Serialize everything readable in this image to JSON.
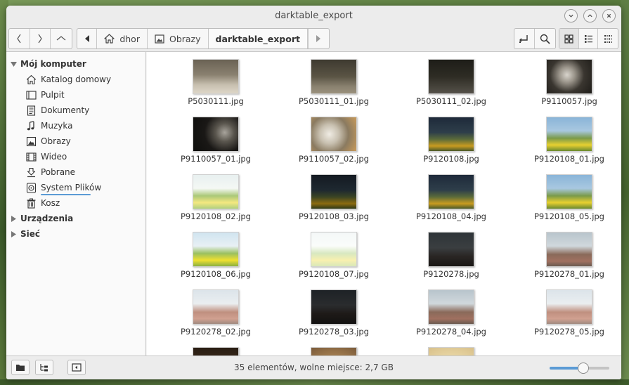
{
  "window": {
    "title": "darktable_export"
  },
  "toolbar": {
    "back_icon": "chevron-left-icon",
    "forward_icon": "chevron-right-icon",
    "up_icon": "chevron-up-icon",
    "breadcrumb": [
      {
        "label": "dhor",
        "icon": "home-icon"
      },
      {
        "label": "Obrazy",
        "icon": "image-folder-icon"
      },
      {
        "label": "darktable_export",
        "icon": ""
      }
    ],
    "active_view": "icons"
  },
  "sidebar": {
    "sections": [
      {
        "label": "Mój komputer",
        "expanded": true
      },
      {
        "label": "Urządzenia",
        "expanded": false
      },
      {
        "label": "Sieć",
        "expanded": false
      }
    ],
    "items": [
      {
        "label": "Katalog domowy",
        "icon": "home-icon"
      },
      {
        "label": "Pulpit",
        "icon": "desktop-icon"
      },
      {
        "label": "Dokumenty",
        "icon": "document-icon"
      },
      {
        "label": "Muzyka",
        "icon": "music-icon"
      },
      {
        "label": "Obrazy",
        "icon": "image-icon"
      },
      {
        "label": "Wideo",
        "icon": "video-icon"
      },
      {
        "label": "Pobrane",
        "icon": "download-icon"
      },
      {
        "label": "System Plików",
        "icon": "drive-icon"
      },
      {
        "label": "Kosz",
        "icon": "trash-icon"
      }
    ]
  },
  "files": [
    {
      "name": "P5030111.jpg",
      "theme": "forest"
    },
    {
      "name": "P5030111_01.jpg",
      "theme": "forest-dark"
    },
    {
      "name": "P5030111_02.jpg",
      "theme": "forest-darker"
    },
    {
      "name": "P9110057.jpg",
      "theme": "sculpture"
    },
    {
      "name": "P9110057_01.jpg",
      "theme": "sculpture-dark"
    },
    {
      "name": "P9110057_02.jpg",
      "theme": "sculpture-light"
    },
    {
      "name": "P9120108.jpg",
      "theme": "fountain-dark"
    },
    {
      "name": "P9120108_01.jpg",
      "theme": "fountain"
    },
    {
      "name": "P9120108_02.jpg",
      "theme": "fountain-light"
    },
    {
      "name": "P9120108_03.jpg",
      "theme": "fountain-darker"
    },
    {
      "name": "P9120108_04.jpg",
      "theme": "fountain-dark"
    },
    {
      "name": "P9120108_05.jpg",
      "theme": "fountain"
    },
    {
      "name": "P9120108_06.jpg",
      "theme": "fountain-bright"
    },
    {
      "name": "P9120108_07.jpg",
      "theme": "fountain-washed"
    },
    {
      "name": "P9120278.jpg",
      "theme": "city-dark"
    },
    {
      "name": "P9120278_01.jpg",
      "theme": "city"
    },
    {
      "name": "P9120278_02.jpg",
      "theme": "city-light"
    },
    {
      "name": "P9120278_03.jpg",
      "theme": "city-darker"
    },
    {
      "name": "P9120278_04.jpg",
      "theme": "city"
    },
    {
      "name": "P9120278_05.jpg",
      "theme": "city-light"
    },
    {
      "name": "",
      "theme": "partial-dark"
    },
    {
      "name": "",
      "theme": "partial-arch"
    },
    {
      "name": "",
      "theme": "partial-arch-light"
    }
  ],
  "statusbar": {
    "text": "35 elementów, wolne miejsce: 2,7 GB",
    "zoom_level": 0.56
  },
  "colors": {
    "accent": "#5b9bd5"
  }
}
